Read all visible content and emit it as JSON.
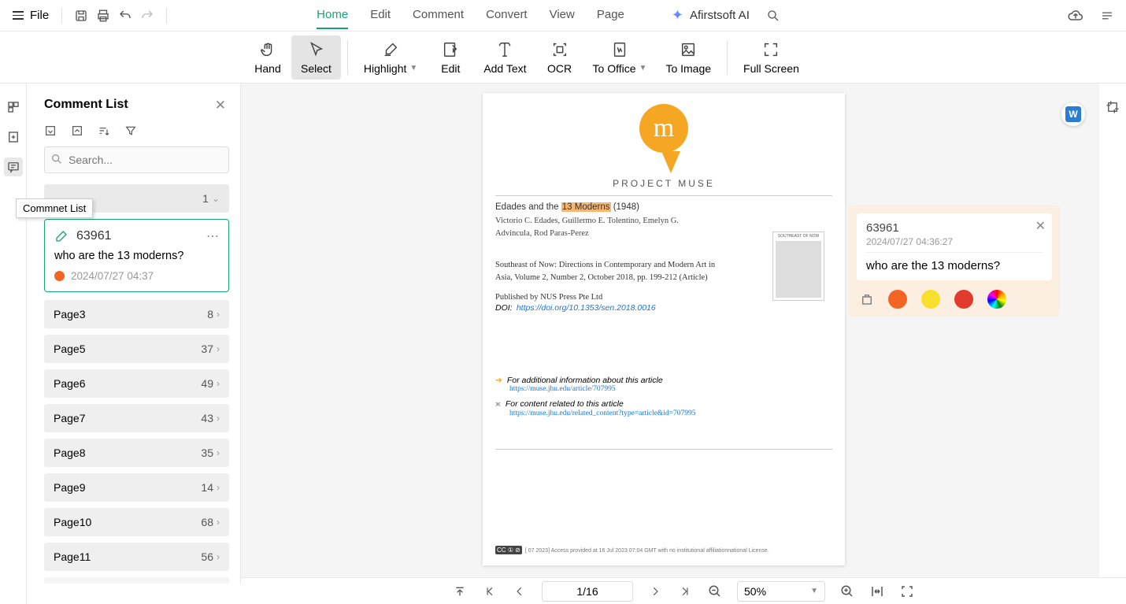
{
  "topbar": {
    "file_label": "File",
    "tabs": [
      "Home",
      "Edit",
      "Comment",
      "Convert",
      "View",
      "Page"
    ],
    "active_tab": "Home",
    "brand": "Afirstsoft AI"
  },
  "toolbar": {
    "tools": [
      {
        "id": "hand",
        "label": "Hand"
      },
      {
        "id": "select",
        "label": "Select",
        "active": true
      },
      {
        "id": "highlight",
        "label": "Highlight",
        "dropdown": true
      },
      {
        "id": "edit",
        "label": "Edit"
      },
      {
        "id": "addtext",
        "label": "Add Text"
      },
      {
        "id": "ocr",
        "label": "OCR"
      },
      {
        "id": "tooffice",
        "label": "To Office",
        "dropdown": true
      },
      {
        "id": "toimage",
        "label": "To Image"
      },
      {
        "id": "fullscreen",
        "label": "Full Screen"
      }
    ]
  },
  "leftrail_tooltip": "Commnet List",
  "comment_panel": {
    "title": "Comment List",
    "search_placeholder": "Search...",
    "pages": [
      {
        "label": "",
        "count": 1,
        "expanded": true
      },
      {
        "label": "Page3",
        "count": 8
      },
      {
        "label": "Page5",
        "count": 37
      },
      {
        "label": "Page6",
        "count": 49
      },
      {
        "label": "Page7",
        "count": 43
      },
      {
        "label": "Page8",
        "count": 35
      },
      {
        "label": "Page9",
        "count": 14
      },
      {
        "label": "Page10",
        "count": 68
      },
      {
        "label": "Page11",
        "count": 56
      }
    ],
    "active_comment": {
      "id": "63961",
      "text": "who are the 13 moderns?",
      "timestamp": "2024/07/27 04:37",
      "color": "#f26522"
    }
  },
  "document": {
    "logo_text": "PROJECT MUSE",
    "title_prefix": "Edades and the ",
    "title_highlight": "13 Moderns",
    "title_suffix": " (1948)",
    "authors": "Victorio C. Edades, Guillermo E. Tolentino, Emelyn G. Advincula, Rod Paras-Perez",
    "journal": "Southeast of Now: Directions in Contemporary and Modern Art in Asia, Volume 2, Number 2, October 2018, pp. 199-212 (Article)",
    "publisher": "Published by NUS Press Pte Ltd",
    "doi_label": "DOI:",
    "doi_url": "https://doi.org/10.1353/sen.2018.0016",
    "info_label": "For additional information about this article",
    "info_url": "https://muse.jhu.edu/article/707995",
    "related_label": "For content related to this article",
    "related_url": "https://muse.jhu.edu/related_content?type=article&id=707995",
    "cover_caption": "SOUTHEAST OF NOW",
    "access_text": "[ 07 2023] Access provided at 16 Jul 2023 07:04 GMT with no institutional affiliation",
    "access_suffix": "national License."
  },
  "annotation_popup": {
    "id": "63961",
    "timestamp": "2024/07/27 04:36:27",
    "text": "who are the 13 moderns?"
  },
  "bottombar": {
    "page_indicator": "1/16",
    "zoom": "50%"
  }
}
